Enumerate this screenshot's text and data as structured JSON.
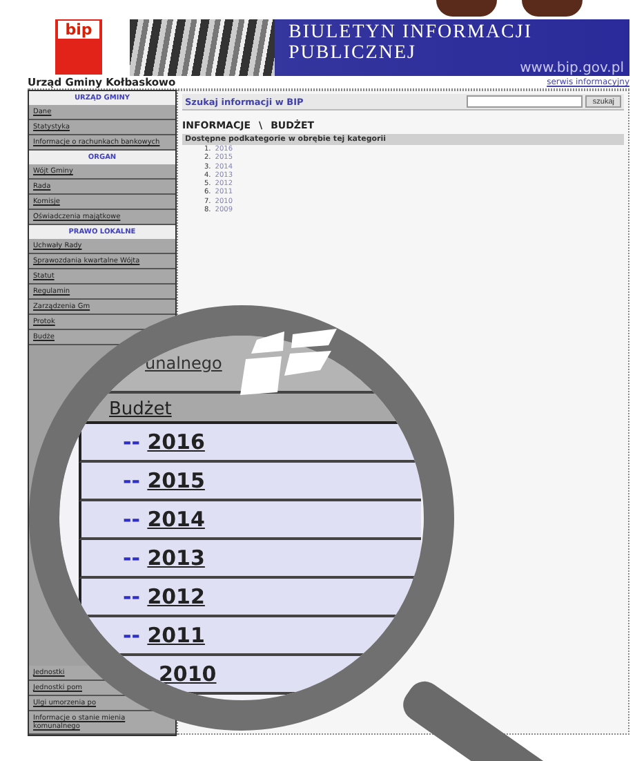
{
  "header": {
    "logo": "bip",
    "title_line_1": "BIULETYN INFORMACJI",
    "title_line_2": "PUBLICZNEJ",
    "site_url": "www.bip.gov.pl"
  },
  "office_name": "Urząd Gminy Kołbaskowo",
  "service_link": "serwis informacyjny",
  "sidebar": {
    "items_top": [
      {
        "kind": "header",
        "label": "URZĄD GMINY"
      },
      {
        "kind": "item",
        "label": "Dane"
      },
      {
        "kind": "item",
        "label": "Statystyka"
      },
      {
        "kind": "item",
        "label": "Informacje o rachunkach bankowych"
      },
      {
        "kind": "header",
        "label": "ORGAN"
      },
      {
        "kind": "item",
        "label": "Wójt Gminy"
      },
      {
        "kind": "item",
        "label": "Rada"
      },
      {
        "kind": "item",
        "label": "Komisje"
      },
      {
        "kind": "item",
        "label": "Oświadczenia majątkowe"
      },
      {
        "kind": "header",
        "label": "PRAWO LOKALNE"
      },
      {
        "kind": "item",
        "label": "Uchwały Rady"
      },
      {
        "kind": "item",
        "label": "Sprawozdania kwartalne Wójta"
      },
      {
        "kind": "item",
        "label": "Statut"
      },
      {
        "kind": "item",
        "label": "Regulamin"
      },
      {
        "kind": "item",
        "label": "Zarządzenia Gm"
      },
      {
        "kind": "item",
        "label": "Protok"
      },
      {
        "kind": "item",
        "label": "Budże"
      }
    ],
    "items_bottom": [
      {
        "kind": "item",
        "label": "Jednostki"
      },
      {
        "kind": "item",
        "label": "Jednostki pom"
      },
      {
        "kind": "item",
        "label": "Ulgi umorzenia po"
      },
      {
        "kind": "item",
        "label": "Informacje o stanie mienia komunalnego"
      }
    ]
  },
  "search": {
    "label": "Szukaj informacji w BIP",
    "button": "szukaj"
  },
  "breadcrumb": [
    "INFORMACJE",
    "\\",
    "BUDŻET"
  ],
  "subcategories_heading": "Dostępne podkategorie w obrębie tej kategorii",
  "subcategories": [
    {
      "number": "1.",
      "label": "2016"
    },
    {
      "number": "2.",
      "label": "2015"
    },
    {
      "number": "3.",
      "label": "2014"
    },
    {
      "number": "4.",
      "label": "2013"
    },
    {
      "number": "5.",
      "label": "2012"
    },
    {
      "number": "6.",
      "label": "2011"
    },
    {
      "number": "7.",
      "label": "2010"
    },
    {
      "number": "8.",
      "label": "2009"
    }
  ],
  "magnifier": {
    "band_text": "unalnego",
    "section": "Budżet",
    "rows": [
      {
        "prefix": "--",
        "year": "2016"
      },
      {
        "prefix": "--",
        "year": "2015"
      },
      {
        "prefix": "--",
        "year": "2014"
      },
      {
        "prefix": "--",
        "year": "2013"
      },
      {
        "prefix": "--",
        "year": "2012"
      },
      {
        "prefix": "--",
        "year": "2011"
      },
      {
        "prefix": "",
        "year": "2010"
      }
    ]
  }
}
